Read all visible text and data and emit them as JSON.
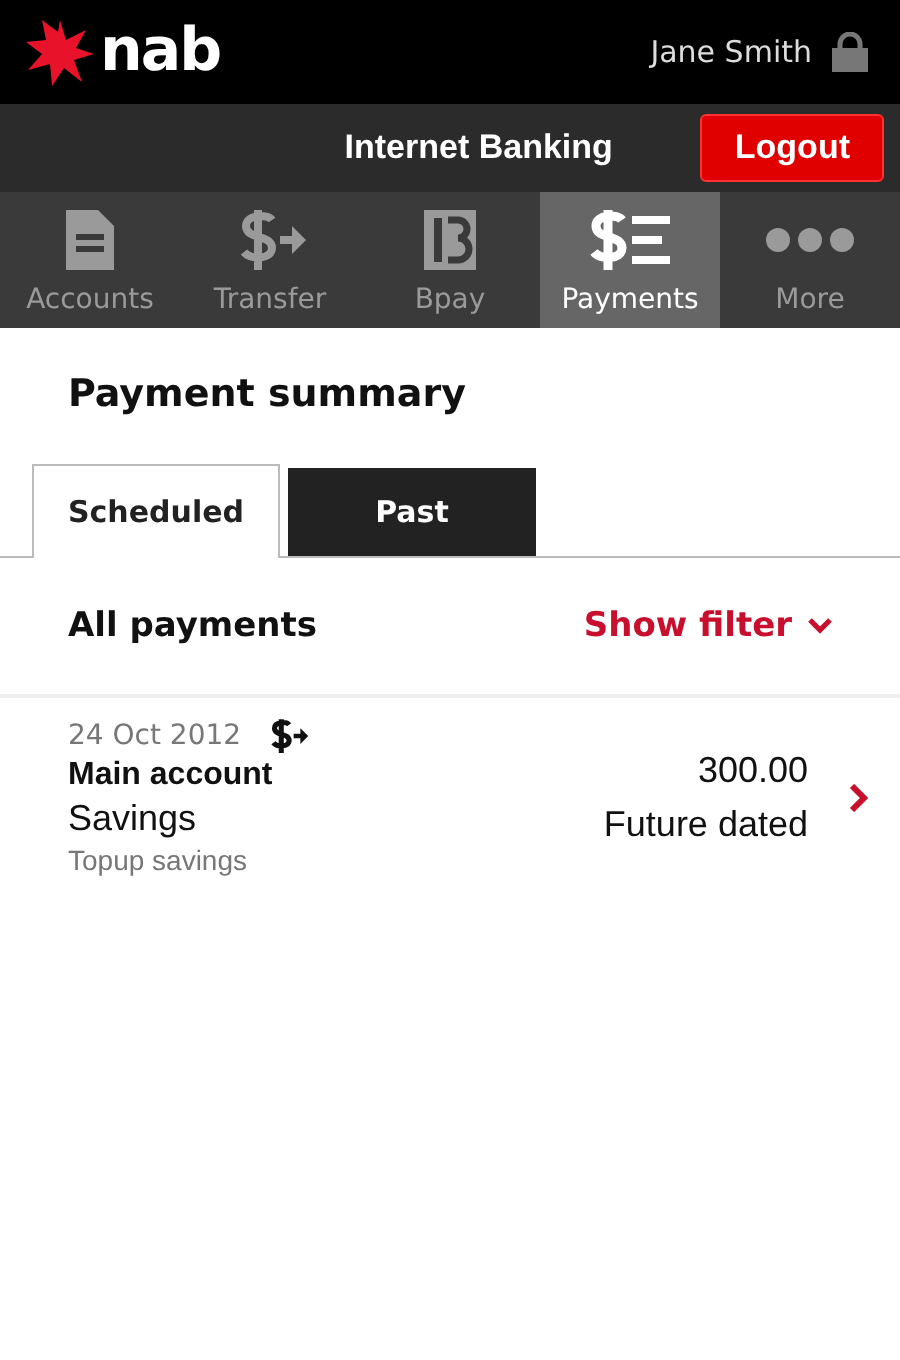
{
  "header": {
    "logo": "nab",
    "user": "Jane Smith"
  },
  "bar": {
    "title": "Internet Banking",
    "button": "Logout"
  },
  "nav": [
    {
      "label": "Accounts",
      "kind": "document",
      "selected": false
    },
    {
      "label": "Transfer",
      "kind": "transfer",
      "selected": false
    },
    {
      "label": "Bpay",
      "kind": "bpay",
      "selected": false
    },
    {
      "label": "Payments",
      "kind": "payments",
      "selected": true
    },
    {
      "label": "More",
      "kind": "more",
      "selected": false
    }
  ],
  "page_title": "Payment summary",
  "tabs": [
    {
      "label": "Scheduled",
      "selected": true
    },
    {
      "label": "Past",
      "selected": false
    }
  ],
  "filter_row": {
    "label": "All payments",
    "link": "Show filter"
  },
  "payments": [
    {
      "date": "24 Oct 2012",
      "kind": "transfer",
      "from": "Main account",
      "to": "Savings",
      "description": "Topup savings",
      "amount": "300.00",
      "status": "Future dated"
    }
  ]
}
